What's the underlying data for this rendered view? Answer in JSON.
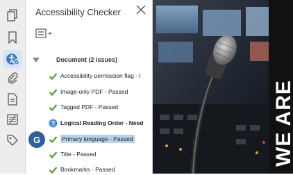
{
  "toolbar": {
    "icons": [
      "pages-icon",
      "bookmark-icon",
      "accessibility-icon",
      "attachment-icon",
      "document-properties-icon",
      "compare-icon",
      "tags-icon"
    ]
  },
  "panel": {
    "title": "Accessibility Checker",
    "options_icon": "options-menu-icon",
    "document_label": "Document (2 issues)",
    "items": [
      {
        "label": "Accessibility permission flag - I",
        "status": "passed"
      },
      {
        "label": "Image-only PDF - Passed",
        "status": "passed"
      },
      {
        "label": "Tagged PDF - Passed",
        "status": "passed"
      },
      {
        "label": "Logical Reading Order - Need",
        "status": "needs-check"
      },
      {
        "label": "Primary language - Passed",
        "status": "passed",
        "selected": true
      },
      {
        "label": "Title - Passed",
        "status": "passed"
      },
      {
        "label": "Bookmarks - Passed",
        "status": "passed"
      }
    ]
  },
  "avatar": {
    "initial": "G",
    "color": "#2e5f9e"
  },
  "photo": {
    "banner_text": "WE ARE"
  },
  "colors": {
    "accent": "#2e5f9e",
    "check": "#5aa531",
    "help": "#4a90d9",
    "selection": "#b6d3ee"
  }
}
